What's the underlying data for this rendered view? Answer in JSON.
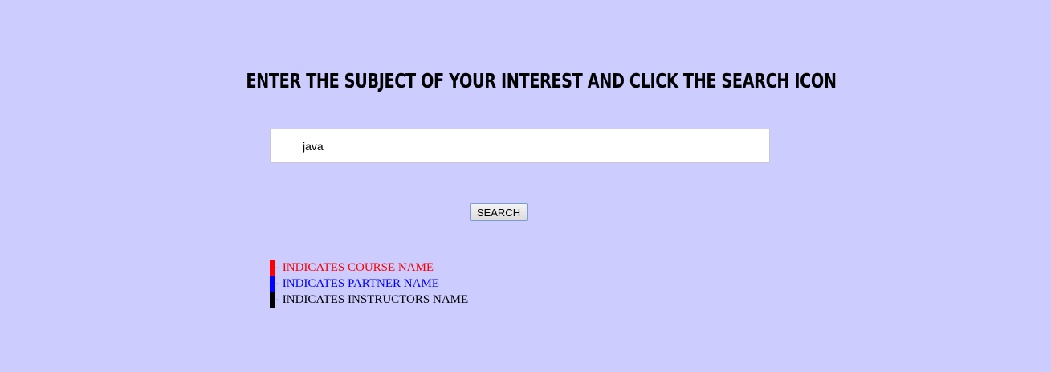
{
  "heading": "ENTER THE SUBJECT OF YOUR INTEREST AND CLICK THE SEARCH ICON",
  "search": {
    "value": "java",
    "button_label": "SEARCH"
  },
  "legend": {
    "items": [
      {
        "text": "- INDICATES COURSE NAME",
        "color": "#ff0000"
      },
      {
        "text": "- INDICATES PARTNER NAME",
        "color": "#0000ff"
      },
      {
        "text": "- INDICATES INSTRUCTORS NAME",
        "color": "#000000"
      }
    ]
  },
  "colors": {
    "background": "#ccccff"
  }
}
